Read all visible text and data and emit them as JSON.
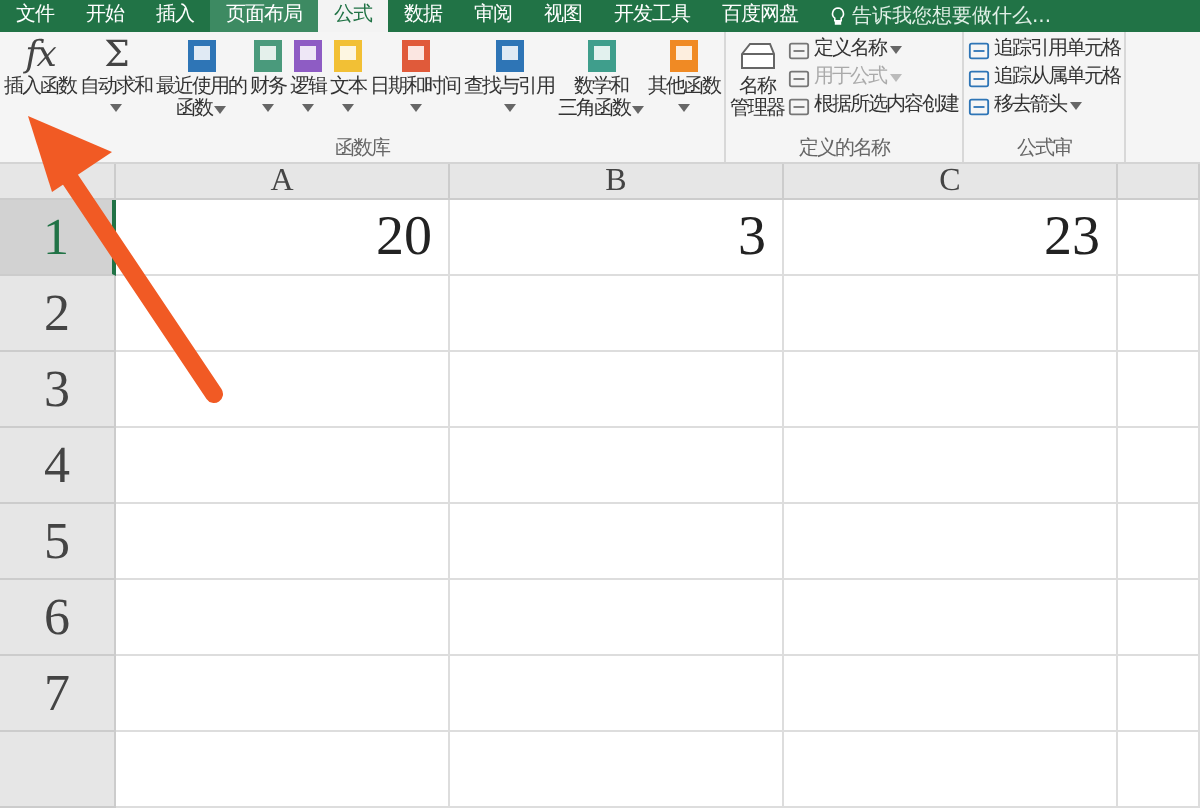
{
  "tabs": [
    {
      "label": "文件",
      "selected": false,
      "hovered": false
    },
    {
      "label": "开始",
      "selected": false,
      "hovered": false
    },
    {
      "label": "插入",
      "selected": false,
      "hovered": false
    },
    {
      "label": "页面布局",
      "selected": false,
      "hovered": true
    },
    {
      "label": "公式",
      "selected": true,
      "hovered": false
    },
    {
      "label": "数据",
      "selected": false,
      "hovered": false
    },
    {
      "label": "审阅",
      "selected": false,
      "hovered": false
    },
    {
      "label": "视图",
      "selected": false,
      "hovered": false
    },
    {
      "label": "开发工具",
      "selected": false,
      "hovered": false
    },
    {
      "label": "百度网盘",
      "selected": false,
      "hovered": false
    }
  ],
  "tell_me": {
    "placeholder": "告诉我您想要做什么..."
  },
  "ribbon": {
    "groups": [
      {
        "label": "函数库",
        "items": [
          {
            "kind": "large",
            "glyph": "fx",
            "lines": [
              "插入函数"
            ],
            "dropdown": false
          },
          {
            "kind": "large",
            "glyph": "Σ",
            "lines": [
              "自动求和"
            ],
            "dropdown": true
          },
          {
            "kind": "large",
            "lines": [
              "最近使用的",
              "函数"
            ],
            "dropdown": true,
            "color": "#2e75b6"
          },
          {
            "kind": "large",
            "lines": [
              "财务"
            ],
            "dropdown": true,
            "color": "#4a9a7c"
          },
          {
            "kind": "large",
            "lines": [
              "逻辑"
            ],
            "dropdown": true,
            "color": "#8e5cc4"
          },
          {
            "kind": "large",
            "lines": [
              "文本"
            ],
            "dropdown": true,
            "color": "#f2c035"
          },
          {
            "kind": "large",
            "lines": [
              "日期和时间"
            ],
            "dropdown": true,
            "color": "#e05a3a"
          },
          {
            "kind": "large",
            "lines": [
              "查找与引用"
            ],
            "dropdown": true,
            "color": "#2e75b6"
          },
          {
            "kind": "large",
            "lines": [
              "数学和",
              "三角函数"
            ],
            "dropdown": true,
            "color": "#3f9e8c"
          },
          {
            "kind": "large",
            "lines": [
              "其他函数"
            ],
            "dropdown": true,
            "color": "#f08a24"
          }
        ]
      },
      {
        "label": "定义的名称",
        "items": [
          {
            "kind": "large",
            "lines": [
              "名称",
              "管理器"
            ],
            "dropdown": false
          },
          {
            "kind": "stack",
            "items": [
              {
                "label": "定义名称",
                "dropdown": true,
                "disabled": false
              },
              {
                "label": "用于公式",
                "dropdown": true,
                "disabled": true
              },
              {
                "label": "根据所选内容创建",
                "dropdown": false,
                "disabled": false
              }
            ]
          }
        ]
      },
      {
        "label": "公式审",
        "items": [
          {
            "kind": "stack",
            "items": [
              {
                "label": "追踪引用单元格",
                "dropdown": false,
                "disabled": false
              },
              {
                "label": "追踪从属单元格",
                "dropdown": false,
                "disabled": false
              },
              {
                "label": "移去箭头",
                "dropdown": true,
                "disabled": false
              }
            ]
          }
        ]
      }
    ]
  },
  "sheet": {
    "columns": [
      "A",
      "B",
      "C"
    ],
    "rows": [
      {
        "number": "1",
        "selected": true,
        "cells": [
          "20",
          "3",
          "23"
        ]
      },
      {
        "number": "2",
        "selected": false
      },
      {
        "number": "3",
        "selected": false
      },
      {
        "number": "4",
        "selected": false
      },
      {
        "number": "5",
        "selected": false
      },
      {
        "number": "6",
        "selected": false
      },
      {
        "number": "7",
        "selected": false
      }
    ]
  }
}
